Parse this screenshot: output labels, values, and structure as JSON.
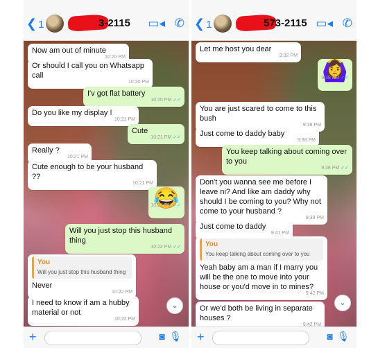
{
  "left": {
    "header": {
      "back_count": "1",
      "contact_suffix": "3-2115"
    },
    "messages": [
      {
        "text": "Now am out of minute",
        "time": "10:20 PM"
      },
      {
        "text": "Or should I call you on Whatsapp call",
        "time": "10:20 PM"
      },
      {
        "text": "I'v got flat battery",
        "time": "10:20 PM"
      },
      {
        "text": "Do you like my display !",
        "time": "10:21 PM"
      },
      {
        "text": "Cute",
        "time": "10:21 PM"
      },
      {
        "text": "Really ?",
        "time": "10:21 PM"
      },
      {
        "text": "Cute enough to be your husband ??",
        "time": "10:21 PM"
      },
      {
        "text": "😂",
        "time": "10:22 PM"
      },
      {
        "text": "Will you just stop this husband thing",
        "time": "10:22 PM"
      },
      {
        "quote_name": "You",
        "quote_text": "Will you just stop this husband thing",
        "text": "Never",
        "time": "10:22 PM"
      },
      {
        "text": "I need to know if am a hubby material or not",
        "time": "10:22 PM"
      }
    ]
  },
  "right": {
    "header": {
      "back_count": "1",
      "contact_suffix": "573-2115"
    },
    "messages": [
      {
        "text": "Let me host you dear",
        "time": "9:32 PM"
      },
      {
        "text": "🙆‍♀️",
        "time": "9:38 PM"
      },
      {
        "text": "You are just scared to come to this bush",
        "time": "9:38 PM"
      },
      {
        "text": "Just come to daddy baby",
        "time": "9:38 PM"
      },
      {
        "text": "You keep talking about coming over to you",
        "time": "9:38 PM"
      },
      {
        "text": "Don't you wanna see me before I leave ni? And like am daddy why should I be coming to you? Why not come to your husband ?",
        "time": "9:39 PM"
      },
      {
        "text": "Just come to daddy",
        "time": "9:41 PM"
      },
      {
        "quote_name": "You",
        "quote_text": "You keep talking about coming over to you",
        "text": "Yeah baby am a man if I marry you will be the one to move into your house or you'd move in to mines?",
        "time": "9:42 PM"
      },
      {
        "text": "Or we'd both be living in separate houses ?",
        "time": "9:42 PM"
      }
    ]
  },
  "colors": {
    "accent": "#1a7ef2",
    "outgoing_bubble": "#dcf8c6",
    "incoming_bubble": "#ffffff",
    "redaction": "#e8111a",
    "quote_name": "#e88a1a",
    "read_tick": "#34b7f1"
  },
  "icons": [
    "chevron-left-icon",
    "video-call-icon",
    "phone-icon",
    "plus-icon",
    "camera-icon",
    "microphone-icon",
    "chevron-down-icon"
  ]
}
